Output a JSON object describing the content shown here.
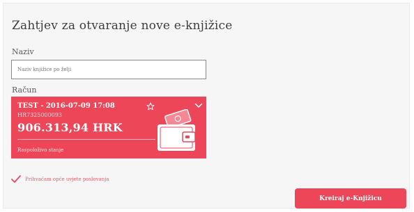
{
  "form": {
    "title": "Zahtjev za otvaranje nove e-knjižice",
    "name_label": "Naziv",
    "name_placeholder": "Naziv knjižice po želji",
    "account_label": "Račun"
  },
  "account": {
    "name": "TEST - 2016-07-09 17:08",
    "iban": "HR7325000093",
    "amount": "906.313,94 HRK",
    "available_label": "Raspoloživo stanje",
    "card_color": "#ed4658"
  },
  "terms": {
    "label": "Prihvaćam opće uvjete poslovanja",
    "checked": true
  },
  "actions": {
    "create_label": "Kreiraj e-Knjižicu",
    "accent": "#ed4658"
  },
  "icons": [
    "star-icon",
    "chevron-down-icon",
    "wallet-icon",
    "checkmark-icon"
  ]
}
